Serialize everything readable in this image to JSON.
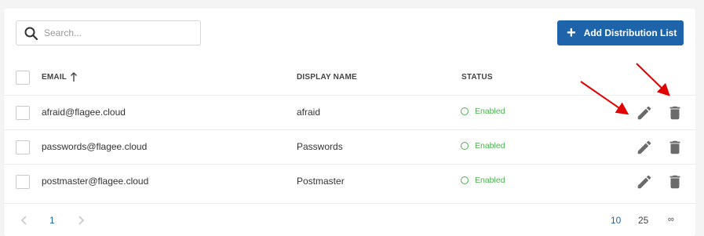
{
  "search": {
    "placeholder": "Search..."
  },
  "toolbar": {
    "add_label": "Add Distribution List"
  },
  "table": {
    "columns": {
      "email": "EMAIL",
      "display_name": "DISPLAY NAME",
      "status": "STATUS"
    },
    "rows": [
      {
        "email": "afraid@flagee.cloud",
        "display_name": "afraid",
        "status": "Enabled"
      },
      {
        "email": "passwords@flagee.cloud",
        "display_name": "Passwords",
        "status": "Enabled"
      },
      {
        "email": "postmaster@flagee.cloud",
        "display_name": "Postmaster",
        "status": "Enabled"
      }
    ]
  },
  "pagination": {
    "current_page": "1",
    "page_sizes": [
      "10",
      "25",
      "∞"
    ]
  },
  "colors": {
    "primary": "#1e64ab",
    "enabled": "#4caf50",
    "annotation": "#e00000"
  }
}
